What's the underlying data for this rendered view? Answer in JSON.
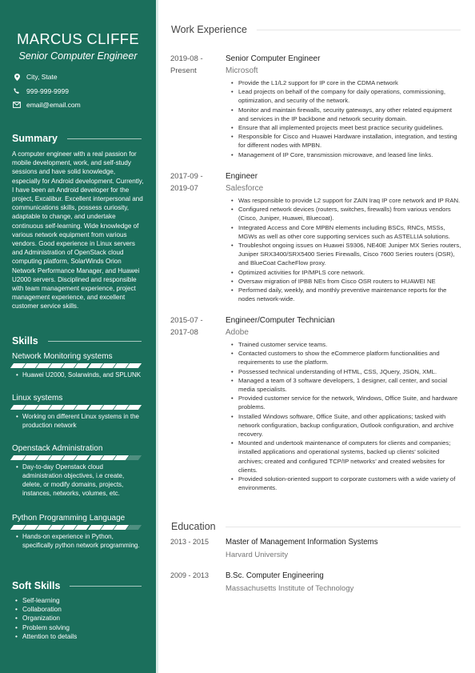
{
  "colors": {
    "sidebar": "#1b6f5c",
    "accent_line": "#dbeae6"
  },
  "profile": {
    "name": "MARCUS CLIFFE",
    "title": "Senior Computer Engineer",
    "contacts": [
      {
        "icon": "location-pin-icon",
        "text": "City, State"
      },
      {
        "icon": "phone-icon",
        "text": "999-999-9999"
      },
      {
        "icon": "envelope-icon",
        "text": "email@email.com"
      }
    ]
  },
  "summary": {
    "heading": "Summary",
    "text": "A computer engineer with a real passion for mobile development, work, and self-study sessions and have solid knowledge, especially for Android development. Currently, I have been an Android developer for the project, Excalibur. Excellent interpersonal and communications skills, possess curiosity, adaptable to change, and undertake continuous self-learning. Wide knowledge of various network equipment from various vendors. Good experience in Linux servers and Administration of OpenStack cloud computing platform, SolarWinds Orion Network Performance Manager, and Huawei U2000 servers. Disciplined and responsible with team management experience, project management experience, and excellent customer service skills."
  },
  "skills": {
    "heading": "Skills",
    "items": [
      {
        "name": "Network Monitoring systems",
        "level": 10,
        "max": 10,
        "bullets": [
          "Huawei U2000, Solarwinds, and SPLUNK"
        ]
      },
      {
        "name": "Linux systems",
        "level": 10,
        "max": 10,
        "bullets": [
          "Working on different Linux systems in the production network"
        ]
      },
      {
        "name": "Openstack Administration",
        "level": 9,
        "max": 10,
        "bullets": [
          "Day-to-day Openstack cloud administration objectives, i.e create, delete, or modify domains, projects, instances, networks, volumes, etc."
        ]
      },
      {
        "name": "Python Programming Language",
        "level": 9,
        "max": 10,
        "bullets": [
          "Hands-on experience in Python, specifically python network programming."
        ]
      }
    ]
  },
  "soft_skills": {
    "heading": "Soft Skills",
    "items": [
      "Self-learning",
      "Collaboration",
      "Organization",
      "Problem solving",
      "Attention to details"
    ]
  },
  "work": {
    "heading": "Work Experience",
    "jobs": [
      {
        "date_start": "2019-08 -",
        "date_end": "Present",
        "role": "Senior Computer Engineer",
        "company": "Microsoft",
        "bullets": [
          "Provide the L1/L2 support for IP core in the CDMA network",
          "Lead projects on behalf of the company for daily operations, commissioning, optimization, and security of the network.",
          "Monitor and maintain firewalls, security gateways, any other related equipment and services in the IP backbone and network security domain.",
          "Ensure that all implemented projects meet best practice security guidelines.",
          "Responsible for Cisco and Huawei Hardware installation, integration, and testing for different nodes with MPBN.",
          "Management of IP Core, transmission microwave, and leased line links."
        ]
      },
      {
        "date_start": "2017-09 -",
        "date_end": "2019-07",
        "role": "Engineer",
        "company": "Salesforce",
        "bullets": [
          "Was responsible to provide L2 support for ZAIN Iraq IP  core network and IP RAN.",
          "Configured network devices (routers, switches, firewalls) from various vendors (Cisco, Juniper, Huawei, Bluecoat).",
          "Integrated Access and Core MPBN elements including BSCs, RNCs, MSSs, MGWs as well as other core supporting services such as ASTELLIA solutions.",
          "Troubleshot ongoing issues on Huawei S9306, NE40E Juniper MX Series routers, Juniper SRX3400/SRX5400 Series Firewalls, Cisco 7600 Series routers (OSR), and BlueCoat CacheFlow proxy.",
          "Optimized activities for IP/MPLS core network.",
          "Oversaw migration of IPBB NEs from Cisco OSR routers to HUAWEI NE",
          "Performed daily, weekly, and monthly preventive maintenance reports for the nodes network-wide."
        ]
      },
      {
        "date_start": "2015-07 -",
        "date_end": "2017-08",
        "role": "Engineer/Computer Technician",
        "company": "Adobe",
        "bullets": [
          "Trained customer service teams.",
          "Contacted customers to show the eCommerce platform functionalities and requirements to use the platform.",
          "Possessed technical understanding of HTML, CSS, JQuery, JSON, XML.",
          "Managed a team of 3 software developers, 1 designer, call center, and social media specialists.",
          "Provided customer service for the network, Windows, Office Suite, and hardware problems.",
          "Installed Windows software, Office Suite, and other applications; tasked with network configuration, backup configuration, Outlook configuration, and archive recovery.",
          "Mounted and undertook maintenance of computers for clients and companies; installed applications and operational systems, backed up clients’ solicited archives; created and configured TCP/IP networks’ and created websites for clients.",
          "Provided solution-oriented support to corporate customers with a wide variety of environments."
        ]
      }
    ]
  },
  "education": {
    "heading": "Education",
    "items": [
      {
        "date": "2013 - 2015",
        "degree": "Master of Management Information Systems",
        "school": "Harvard University"
      },
      {
        "date": "2009 - 2013",
        "degree": "B.Sc. Computer Engineering",
        "school": "Massachusetts Institute of Technology"
      }
    ]
  }
}
